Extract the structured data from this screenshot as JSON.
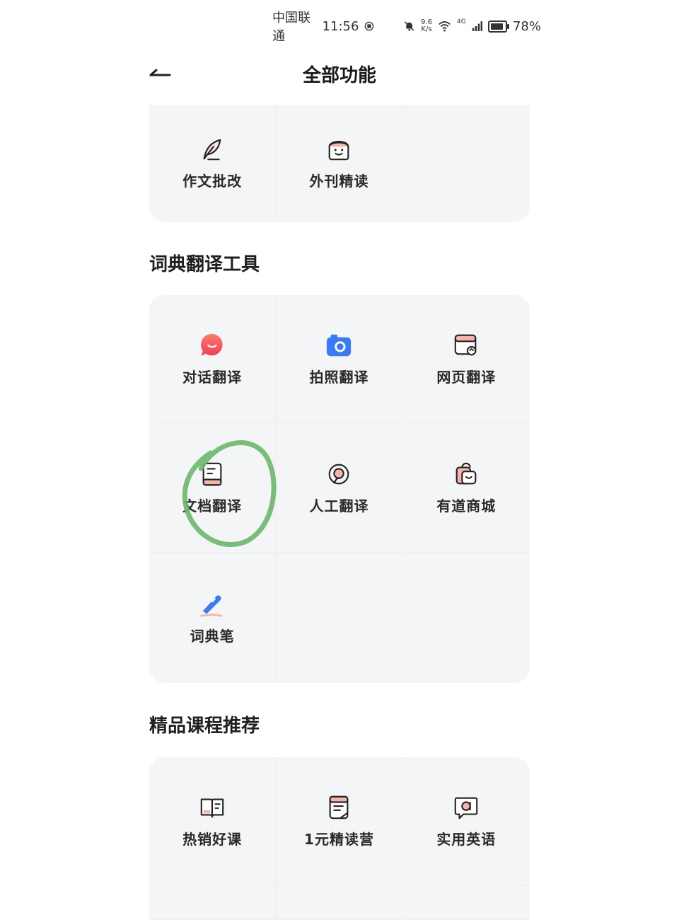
{
  "status_bar": {
    "carrier": "中国联通",
    "time": "11:56",
    "net_speed_value": "9.6",
    "net_speed_unit": "K/s",
    "signal_label": "4G",
    "battery": "78%"
  },
  "header": {
    "title": "全部功能"
  },
  "top_tools": [
    {
      "label": "作文批改",
      "icon": "quill-icon"
    },
    {
      "label": "外刊精读",
      "icon": "bread-face-icon"
    }
  ],
  "dict_section": {
    "title": "词典翻译工具",
    "items": [
      {
        "label": "对话翻译",
        "icon": "chat-bubble-icon"
      },
      {
        "label": "拍照翻译",
        "icon": "camera-icon"
      },
      {
        "label": "网页翻译",
        "icon": "webpage-icon"
      },
      {
        "label": "文档翻译",
        "icon": "document-icon"
      },
      {
        "label": "人工翻译",
        "icon": "headset-icon"
      },
      {
        "label": "有道商城",
        "icon": "shopping-bag-icon"
      },
      {
        "label": "词典笔",
        "icon": "dictionary-pen-icon"
      }
    ]
  },
  "course_section": {
    "title": "精品课程推荐",
    "items": [
      {
        "label": "热销好课",
        "icon": "book-icon"
      },
      {
        "label": "1元精读营",
        "icon": "notebook-icon"
      },
      {
        "label": "实用英语",
        "icon": "speech-a-icon"
      }
    ]
  },
  "colors": {
    "panel_bg": "#f4f5f7",
    "accent_red": "#f2545b",
    "accent_blue": "#3478f6",
    "highlight_green": "#6ab86a"
  }
}
